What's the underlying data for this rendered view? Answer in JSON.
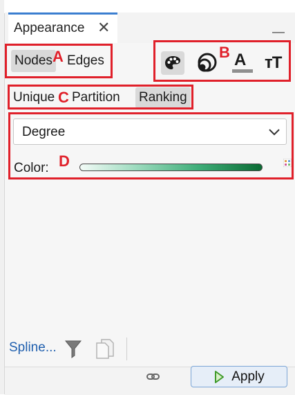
{
  "window": {
    "tab_title": "Appearance",
    "close_glyph": "✕"
  },
  "element_type": {
    "options": [
      "Nodes",
      "Edges"
    ],
    "selected": "Nodes"
  },
  "attribute_icons": [
    "palette-icon",
    "size-icon",
    "label-color-icon",
    "label-size-icon"
  ],
  "label_color_glyph": "A",
  "label_size_glyph": "тT",
  "mode_tabs": {
    "options": [
      "Unique",
      "Partition",
      "Ranking"
    ],
    "selected": "Ranking"
  },
  "ranking": {
    "attribute": "Degree",
    "color_label": "Color:",
    "gradient_colors": [
      "#f3fbf7",
      "#9fdcc0",
      "#3fae79",
      "#0a6b33"
    ]
  },
  "annotations": {
    "a": "A",
    "b": "B",
    "c": "C",
    "d": "D",
    "color": "#e0202a"
  },
  "bottom": {
    "spline_link": "Spline...",
    "apply_label": "Apply"
  }
}
